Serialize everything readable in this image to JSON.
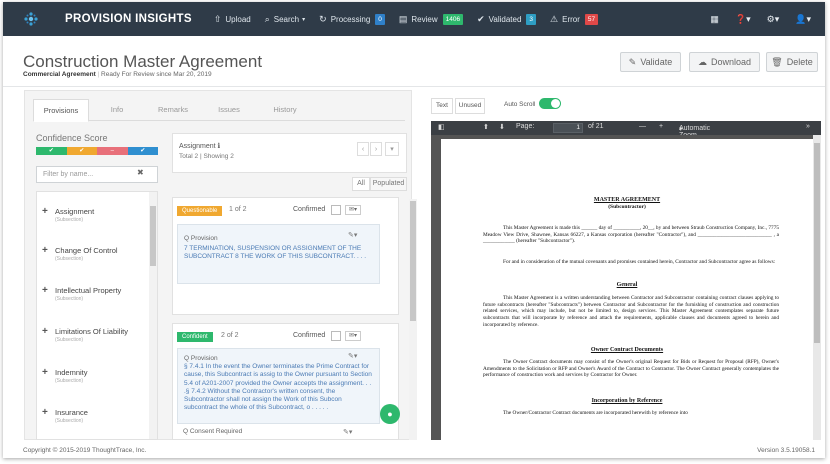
{
  "nav": {
    "brand": "PROVISION INSIGHTS",
    "upload": "Upload",
    "search": "Search",
    "processing": "Processing",
    "processing_count": "0",
    "review": "Review",
    "review_count": "1406",
    "validated": "Validated",
    "validated_count": "3",
    "error": "Error",
    "error_count": "57",
    "colors": {
      "processing": "#2f80c9",
      "review": "#2eb86d",
      "validated": "#2e9ec4",
      "error": "#e04848"
    }
  },
  "header": {
    "title": "Construction Master Agreement",
    "agreement_type": "Commercial Agreement",
    "status": "Ready For Review since Mar 20, 2019",
    "validate_label": "Validate",
    "download_label": "Download",
    "delete_label": "Delete"
  },
  "tabs": [
    "Provisions",
    "Info",
    "Remarks",
    "Issues",
    "History"
  ],
  "confidence": {
    "title": "Confidence Score",
    "colors": [
      "#2eb86d",
      "#f0a830",
      "#e8707a",
      "#2f8fd0"
    ]
  },
  "filter": {
    "placeholder": "Filter by name..."
  },
  "provisions": [
    {
      "name": "Assignment",
      "sub": "(Subsection)"
    },
    {
      "name": "Change Of Control",
      "sub": "(Subsection)"
    },
    {
      "name": "Intellectual Property",
      "sub": "(Subsection)"
    },
    {
      "name": "Limitations Of Liability",
      "sub": "(Subsection)"
    },
    {
      "name": "Indemnity",
      "sub": "(Subsection)"
    },
    {
      "name": "Insurance",
      "sub": "(Subsection)"
    }
  ],
  "detail": {
    "title": "Assignment",
    "total": "Total 2 | Showing 2",
    "filter_all": "All",
    "filter_populated": "Populated",
    "cards": [
      {
        "tag": "Questionable",
        "tag_color": "#f0a830",
        "count": "1 of 2",
        "confirmed": "Confirmed",
        "label": "Q Provision",
        "text": "7 TERMINATION, SUSPENSION OR ASSIGNMENT OF THE SUBCONTRACT 8 THE WORK OF THIS SUBCONTRACT. . . ."
      },
      {
        "tag": "Confident",
        "tag_color": "#2eb86d",
        "count": "2 of 2",
        "confirmed": "Confirmed",
        "label": "Q Provision",
        "text": "§ 7.4.1 In the event the Owner terminates the Prime Contract for cause, this Subcontract is assig to the Owner pursuant to Section 5.4 of A201-2007 provided the Owner accepts the assignment. . . .§ 7.4.2 Without the Contractor's written consent, the Subcontractor shall not assign the Work of this Subcon subcontract the whole of this Subcontract, o . . . . ."
      }
    ],
    "next_label": "Q Consent Required"
  },
  "viewer": {
    "text_btn": "Text",
    "unused_btn": "Unused",
    "auto_scroll": "Auto Scroll",
    "page_label": "Page:",
    "page_num": "1",
    "page_of": "of 21",
    "zoom": "Automatic Zoom"
  },
  "pdf": {
    "title": "MASTER AGREEMENT",
    "subtitle": "(Subcontractor)",
    "p1": "This Master Agreement is made this ______ day of __________, 20__, by and between Straub Construction Company, Inc., 7775 Meadow View Drive, Shawnee, Kansas 66227, a Kansas corporation (hereafter \"Contractor\"), and ____________________________ , a ____________ (hereafter \"Subcontractor\").",
    "p2": "For and in consideration of the mutual covenants and promises contained herein, Contractor and Subcontractor agree as follows:",
    "h1": "General",
    "p3": "This Master Agreement is a written understanding between Contractor and Subcontractor containing contract clauses applying to future subcontracts (hereafter \"Subcontracts\") between Contractor and Subcontractor for the furnishing of construction and construction related services, which may include, but not be limited to, design services. This Master Agreement contemplates separate future subcontracts that will incorporate by reference and attach the requirements, applicable clauses and documents agreed to herein and incorporated by reference.",
    "h2": "Owner Contract Documents",
    "p4": "The Owner Contract documents may consist of the Owner's original Request for Bids or Request for Proposal (RFP), Owner's Amendments to the Solicitation or RFP and Owner's Award of the Contract to Contractor. The Owner Contract generally contemplates the performance of construction work and services by Contractor for Owner.",
    "h3": "Incorporation by Reference",
    "p5": "The Owner/Contractor Contract documents are incorporated herewith by reference into"
  },
  "footer": {
    "copyright": "Copyright © 2015-2019 ThoughtTrace, Inc.",
    "version": "Version 3.5.19058.1"
  }
}
